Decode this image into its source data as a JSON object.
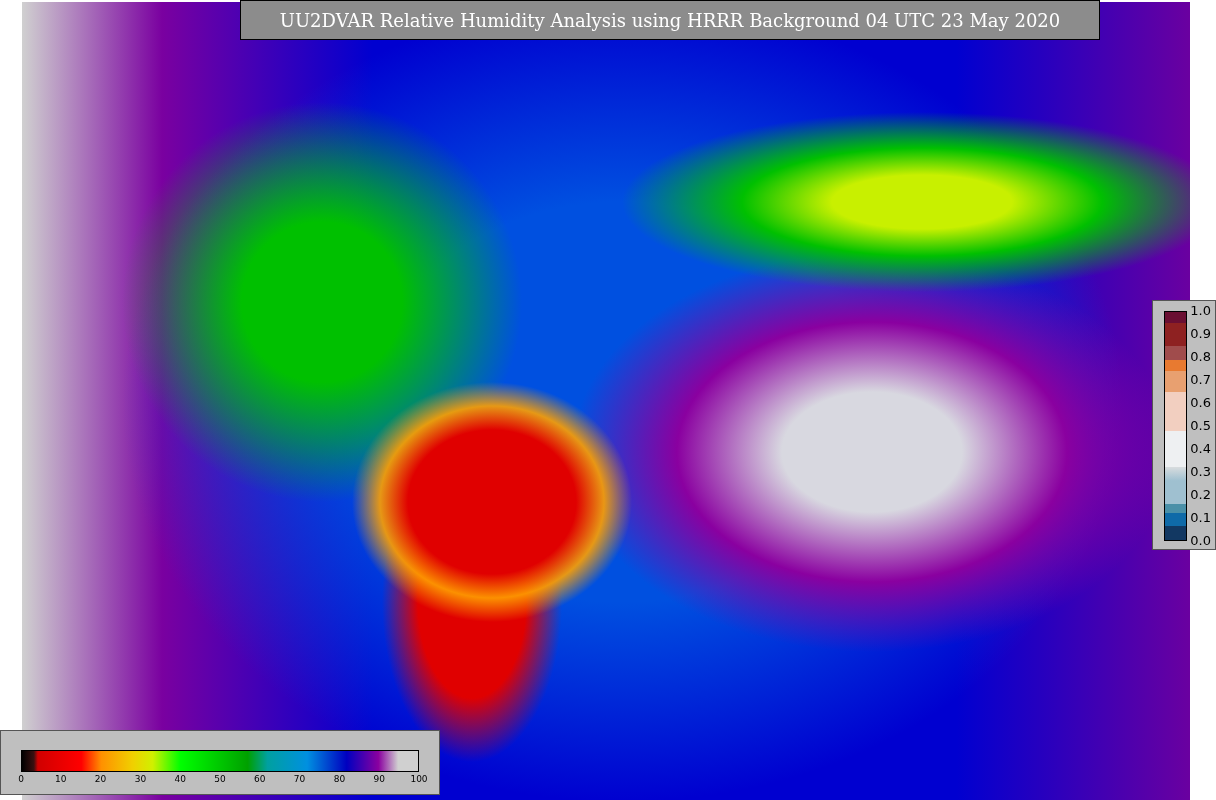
{
  "title": "UU2DVAR Relative Humidity Analysis using HRRR Background 04 UTC 23 May 2020",
  "humidity_legend": {
    "ticks": [
      "0",
      "10",
      "20",
      "30",
      "40",
      "50",
      "60",
      "70",
      "80",
      "90",
      "100"
    ]
  },
  "quality_legend": {
    "ticks": [
      "1.0",
      "0.9",
      "0.8",
      "0.7",
      "0.6",
      "0.5",
      "0.4",
      "0.3",
      "0.2",
      "0.1",
      "0.0"
    ]
  }
}
